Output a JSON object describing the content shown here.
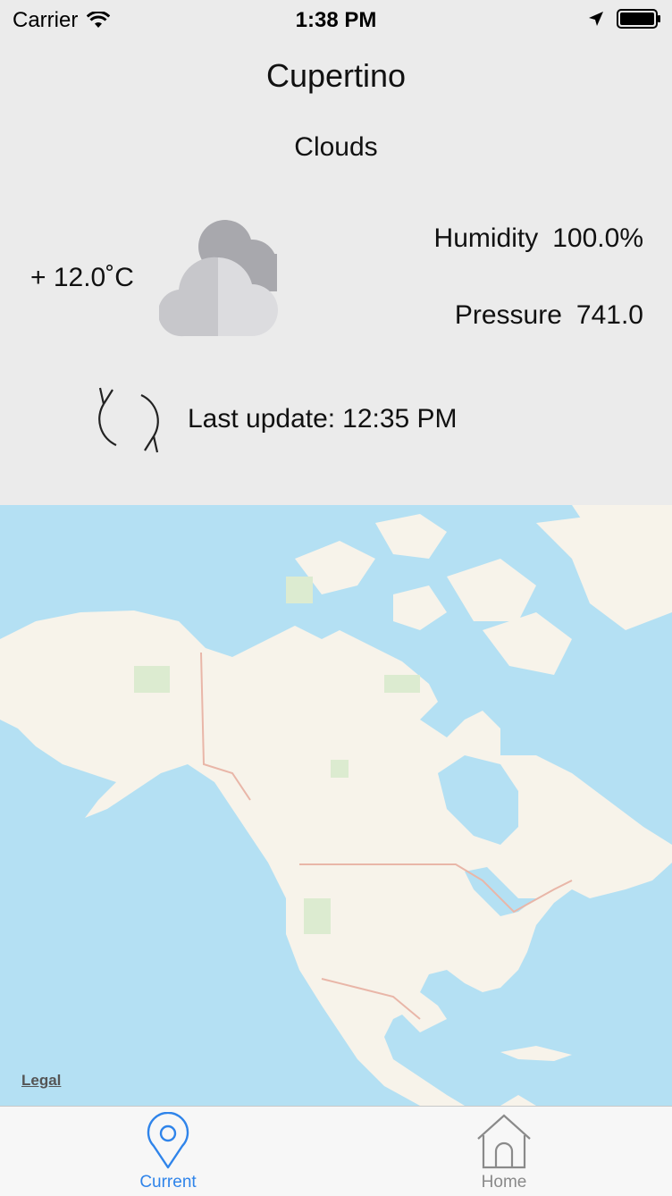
{
  "status_bar": {
    "carrier": "Carrier",
    "time": "1:38 PM",
    "icons": [
      "wifi-icon",
      "location-arrow-icon",
      "battery-icon"
    ]
  },
  "weather": {
    "city": "Cupertino",
    "condition": "Clouds",
    "temperature": "+ 12.0˚C",
    "icon": "clouds-icon",
    "humidity_label": "Humidity",
    "humidity_value": "100.0%",
    "pressure_label": "Pressure",
    "pressure_value": "741.0",
    "last_update_label": "Last update:",
    "last_update_value": "12:35 PM",
    "refresh_icon": "refresh-icon"
  },
  "map": {
    "legal_label": "Legal",
    "colors": {
      "water": "#b4e0f3",
      "land": "#f7f3ea",
      "parks": "#dcebd0",
      "borders": "#e9b6a8"
    }
  },
  "tab_bar": {
    "tabs": [
      {
        "label": "Current",
        "icon": "location-pin-icon",
        "selected": true
      },
      {
        "label": "Home",
        "icon": "house-icon",
        "selected": false
      }
    ],
    "active_color": "#2f84ea",
    "inactive_color": "#8a8a8a"
  }
}
